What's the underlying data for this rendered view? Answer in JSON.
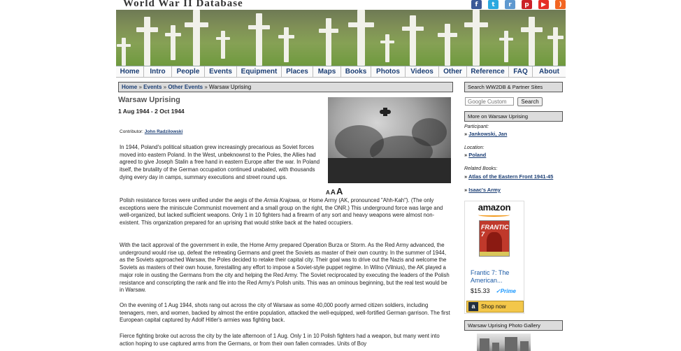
{
  "site": {
    "title": "World War II Database"
  },
  "social_icons": [
    {
      "name": "facebook-icon",
      "glyph": "f",
      "color": "#3b5998"
    },
    {
      "name": "twitter-icon",
      "glyph": "t",
      "color": "#2aa9e0"
    },
    {
      "name": "reddit-icon",
      "glyph": "r",
      "color": "#5f99cf"
    },
    {
      "name": "pinterest-icon",
      "glyph": "p",
      "color": "#cb2027"
    },
    {
      "name": "youtube-icon",
      "glyph": "▶",
      "color": "#e52d27"
    },
    {
      "name": "rss-icon",
      "glyph": ")",
      "color": "#f26522"
    }
  ],
  "nav": [
    "Home",
    "Intro",
    "People",
    "Events",
    "Equipment",
    "Places",
    "Maps",
    "Books",
    "Photos",
    "Videos",
    "Other",
    "Reference",
    "FAQ",
    "About"
  ],
  "breadcrumb": {
    "home": "Home",
    "events": "Events",
    "other_events": "Other Events",
    "current": "Warsaw Uprising",
    "separator": "»"
  },
  "article": {
    "title": "Warsaw Uprising",
    "date_range": "1 Aug 1944 - 2 Oct 1944",
    "contributor_label": "Contributor:",
    "contributor_name": "John Radzilowski",
    "font_sizer": [
      "A",
      "A",
      "A"
    ],
    "p1": "In 1944, Poland's political situation grew increasingly precarious as Soviet forces moved into eastern Poland. In the West, unbeknownst to the Poles, the Allies had agreed to give Joseph Stalin a free hand in eastern Europe after the war. In Poland itself, the brutality of the German occupation continued unabated, with thousands dying every day in camps, summary executions and street round ups.",
    "p2_before": "Polish resistance forces were unified under the aegis of the ",
    "p2_italic": "Armia Krajowa",
    "p2_after": ", or Home Army (AK, pronounced \"Ahh-Kah\"). (The only exceptions were the miniscule Communist movement and a small group on the right, the ONR.) This underground force was large and well-organized, but lacked sufficient weapons. Only 1 in 10 fighters had a firearm of any sort and heavy weapons were almost non-existent. This organization prepared for an uprising that would strike back at the hated occupiers.",
    "p3": "With the tacit approval of the government in exile, the Home Army prepared Operation Burza or Storm. As the Red Army advanced, the underground would rise up, defeat the retreating Germans and greet the Soviets as master of their own country. In the summer of 1944, as the Soviets approached Warsaw, the Poles decided to retake their capital city. Their goal was to drive out the Nazis and welcome the Soviets as masters of their own house, forestalling any effort to impose a Soviet-style puppet regime. In Wilno (Vilnius), the AK played a major role in ousting the Germans from the city and helping the Red Army. The Soviet reciprocated by executing the leaders of the Polish resistance and conscripting the rank and file into the Red Army's Polish units. This was an ominous beginning, but the real test would be in Warsaw.",
    "p4": "On the evening of 1 Aug 1944, shots rang out across the city of Warsaw as some 40,000 poorly armed citizen soldiers, including teenagers, men, and women, backed by almost the entire population, attacked the well-equipped, well-fortified German garrison. The first European capital captured by Adolf Hitler's armies was fighting back.",
    "p5": "Fierce fighting broke out across the city by the late afternoon of 1 Aug. Only 1 in 10 Polish fighters had a weapon, but many went into action hoping to use captured arms from the Germans, or from their own fallen comrades. Units of Boy"
  },
  "sidebar": {
    "search_header": "Search WW2DB & Partner Sites",
    "search_placeholder": "Google Custom",
    "search_button": "Search",
    "more_header": "More on Warsaw Uprising",
    "participant_label": "Participant:",
    "participant_link": "Jankowski, Jan",
    "location_label": "Location:",
    "location_link": "Poland",
    "related_label": "Related Books:",
    "book1": "Atlas of the Eastern Front 1941-45",
    "book2": "Isaac's Army",
    "bullet": "»",
    "gallery_header": "Warsaw Uprising Photo Gallery"
  },
  "ad": {
    "logo": "amazon",
    "book_cover_text": "FRANTIC 7",
    "title": "Frantic 7: The American...",
    "price": "$15.33",
    "prime": "✓Prime",
    "shop_label": "Shop now",
    "shop_icon": "a"
  }
}
